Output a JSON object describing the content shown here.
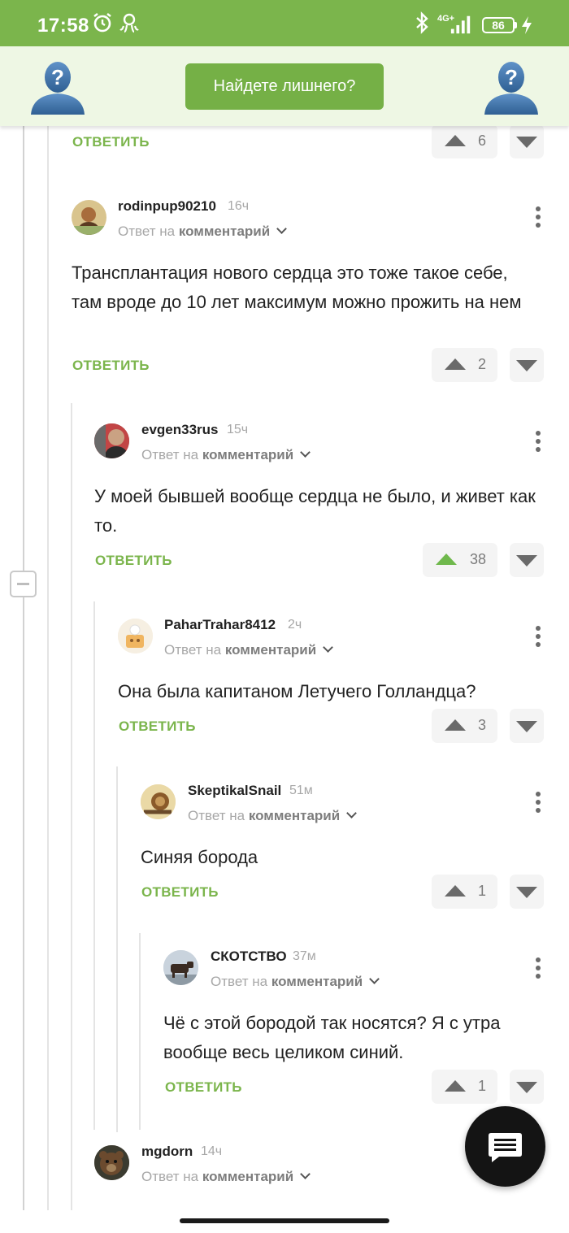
{
  "status_bar": {
    "time": "17:58",
    "network": "4G+",
    "battery": "86",
    "icons": [
      "alarm-icon",
      "octopus-notification-icon",
      "bluetooth-icon",
      "signal-icon",
      "charging-icon"
    ]
  },
  "banner": {
    "button_label": "Найдете лишнего?",
    "left_icon": "mystery-person-icon",
    "right_icon": "mystery-person-icon"
  },
  "labels": {
    "answer": "ОТВЕТИТЬ",
    "reply_prefix": "Ответ на",
    "reply_target": "комментарий"
  },
  "colors": {
    "accent": "#7bb54c",
    "banner_bg": "#eef7e4",
    "upvoted": "#6fb84c"
  },
  "top_partial": {
    "votes": "6"
  },
  "comments": [
    {
      "author": "rodinpup90210",
      "time": "16ч",
      "text": "Трансплантация нового сердца это тоже такое себе, там вроде до 10 лет максимум можно прожить на нем",
      "votes": "2",
      "upvoted": false
    },
    {
      "author": "evgen33rus",
      "time": "15ч",
      "text": "У моей бывшей вообще сердца не было, и живет как то.",
      "votes": "38",
      "upvoted": true
    },
    {
      "author": "PaharTrahar8412",
      "time": "2ч",
      "text": "Она была капитаном Летучего Голландца?",
      "votes": "3",
      "upvoted": false
    },
    {
      "author": "SkeptikalSnail",
      "time": "51м",
      "text": "Синяя борода",
      "votes": "1",
      "upvoted": false
    },
    {
      "author": "СКОТСТВО",
      "time": "37м",
      "text": "Чё с этой бородой так носятся? Я с утра вообще весь целиком синий.",
      "votes": "1",
      "upvoted": false
    },
    {
      "author": "mgdorn",
      "time": "14ч"
    }
  ],
  "fab_icon": "chat-icon"
}
